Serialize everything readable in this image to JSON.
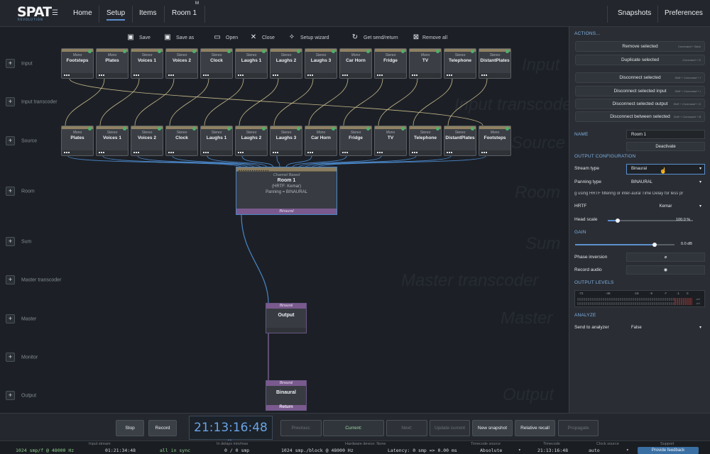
{
  "app": {
    "logo": "SPAT",
    "logo_sub": "REVOLUTION"
  },
  "tabs": {
    "home": "Home",
    "setup": "Setup",
    "items": "Items",
    "room": "Room 1",
    "room_marker": "M"
  },
  "top_right": {
    "snapshots": "Snapshots",
    "preferences": "Preferences"
  },
  "toolbar": {
    "save": "Save",
    "save_as": "Save as",
    "open": "Open",
    "close": "Close",
    "setup_wizard": "Setup wizard",
    "get_send_return": "Get send/return",
    "remove_all": "Remove all"
  },
  "rows": {
    "input": "Input",
    "input_transcoder": "Input transcoder",
    "source": "Source",
    "room": "Room",
    "sum": "Sum",
    "master_transcoder": "Master transcoder",
    "master": "Master",
    "monitor": "Monitor",
    "output": "Output"
  },
  "ghost_labels": {
    "input": "Input",
    "transcoder": "Input transcoder",
    "source": "Source",
    "room": "Room",
    "sum": "Sum",
    "master_transcoder": "Master transcoder",
    "master": "Master",
    "output": "Output"
  },
  "input_nodes": [
    {
      "type": "Mono",
      "name": "Footsteps"
    },
    {
      "type": "Mono",
      "name": "Plates"
    },
    {
      "type": "Stereo",
      "name": "Voices 1"
    },
    {
      "type": "Stereo",
      "name": "Voices 2"
    },
    {
      "type": "Stereo",
      "name": "Clock"
    },
    {
      "type": "Stereo",
      "name": "Laughs 1"
    },
    {
      "type": "Stereo",
      "name": "Laughs 2"
    },
    {
      "type": "Stereo",
      "name": "Laughs 3"
    },
    {
      "type": "Mono",
      "name": "Car Horn"
    },
    {
      "type": "Stereo",
      "name": "Fridge"
    },
    {
      "type": "Mono",
      "name": "TV"
    },
    {
      "type": "Stereo",
      "name": "Telephone"
    },
    {
      "type": "Stereo",
      "name": "DistantPlates"
    }
  ],
  "source_nodes": [
    {
      "type": "Mono",
      "name": "Plates"
    },
    {
      "type": "Stereo",
      "name": "Voices 1"
    },
    {
      "type": "Stereo",
      "name": "Voices 2"
    },
    {
      "type": "Stereo",
      "name": "Clock"
    },
    {
      "type": "Stereo",
      "name": "Laughs 1"
    },
    {
      "type": "Stereo",
      "name": "Laughs 2"
    },
    {
      "type": "Stereo",
      "name": "Laughs 3"
    },
    {
      "type": "Mono",
      "name": "Car Horn"
    },
    {
      "type": "Stereo",
      "name": "Fridge"
    },
    {
      "type": "Mono",
      "name": "TV"
    },
    {
      "type": "Stereo",
      "name": "Telephone"
    },
    {
      "type": "Stereo",
      "name": "DistantPlates"
    },
    {
      "type": "Mono",
      "name": "Footsteps"
    }
  ],
  "room_node": {
    "type": "Channel Based",
    "name": "Room 1",
    "line1": "(HRTF: Kemar)",
    "line2": "Panning = BINAURAL",
    "footer": "Binaural"
  },
  "master_node": {
    "type": "Binaural",
    "name": "Output"
  },
  "output_node": {
    "type": "Binaural",
    "name": "Binaural",
    "footer": "Return"
  },
  "panel": {
    "actions_title": "ACTIONS...",
    "actions": [
      {
        "label": "Remove selected",
        "shortcut": "Command + Back"
      },
      {
        "label": "Duplicate selected",
        "shortcut": "Command + D"
      },
      {
        "label": "Disconnect selected",
        "shortcut": "Shift + Command + I"
      },
      {
        "label": "Disconnect selected input",
        "shortcut": "Shift + Command + I"
      },
      {
        "label": "Disconnect selected output",
        "shortcut": "Shift + Command + O"
      },
      {
        "label": "Disconnect between selected",
        "shortcut": "Shift + Command + B"
      }
    ],
    "name_label": "NAME",
    "name_value": "Room 1",
    "deactivate": "Deactivate",
    "output_config": "OUTPUT CONFIGURATION",
    "stream_type_label": "Stream type",
    "stream_type_value": "Binaural",
    "panning_type_label": "Panning type",
    "panning_type_value": "BINAURAL",
    "panning_desc": "g using HRTF filtering or inter-aural Time Delay for less pr",
    "hrtf_label": "HRTF",
    "hrtf_value": "Kemar",
    "head_scale_label": "Head scale",
    "head_scale_value": "100.0 %",
    "head_scale_level": 0.12,
    "gain_title": "GAIN",
    "gain_value": "0.0 dB",
    "gain_level": 0.8,
    "phase_label": "Phase inversion",
    "record_label": "Record audio",
    "levels_title": "OUTPUT LEVELS",
    "meter_ticks": [
      "-72",
      "-48",
      "-18",
      "-9",
      "-7",
      "-1",
      "0"
    ],
    "meter_right": [
      "-inf",
      "-inf"
    ],
    "analyze_title": "ANALYZE",
    "send_label": "Send to analyzer",
    "send_value": "False"
  },
  "transport": {
    "stop": "Stop",
    "record": "Record",
    "time": "21:13:16:48",
    "previous": "Previous:",
    "current": "Current:",
    "next": "Next:",
    "update": "Update current",
    "new_snapshot": "New snapshot",
    "relative_recall": "Relative recall",
    "propagate": "Propagate"
  },
  "status": {
    "h_input": "Input stream",
    "v_input": "1024 smp/f @ 48000 Hz",
    "v_time": "01:21:34:48",
    "v_sync": "all in sync",
    "h_delays": "In delays min/max",
    "v_delays": "0 / 0 smp",
    "h_hardware": "Hardware device: None",
    "v_block": "1024 smp./block @ 48000 Hz",
    "v_latency": "Latency: 0 smp => 0.00 ms",
    "h_tcsource": "Timecode source",
    "v_tcsource": "Absolute",
    "h_tc": "Timecode",
    "v_tc": "21:13:16:48",
    "h_clock": "Clock source",
    "v_clock": "auto",
    "h_support": "Support",
    "v_support": "Provide feedback"
  }
}
